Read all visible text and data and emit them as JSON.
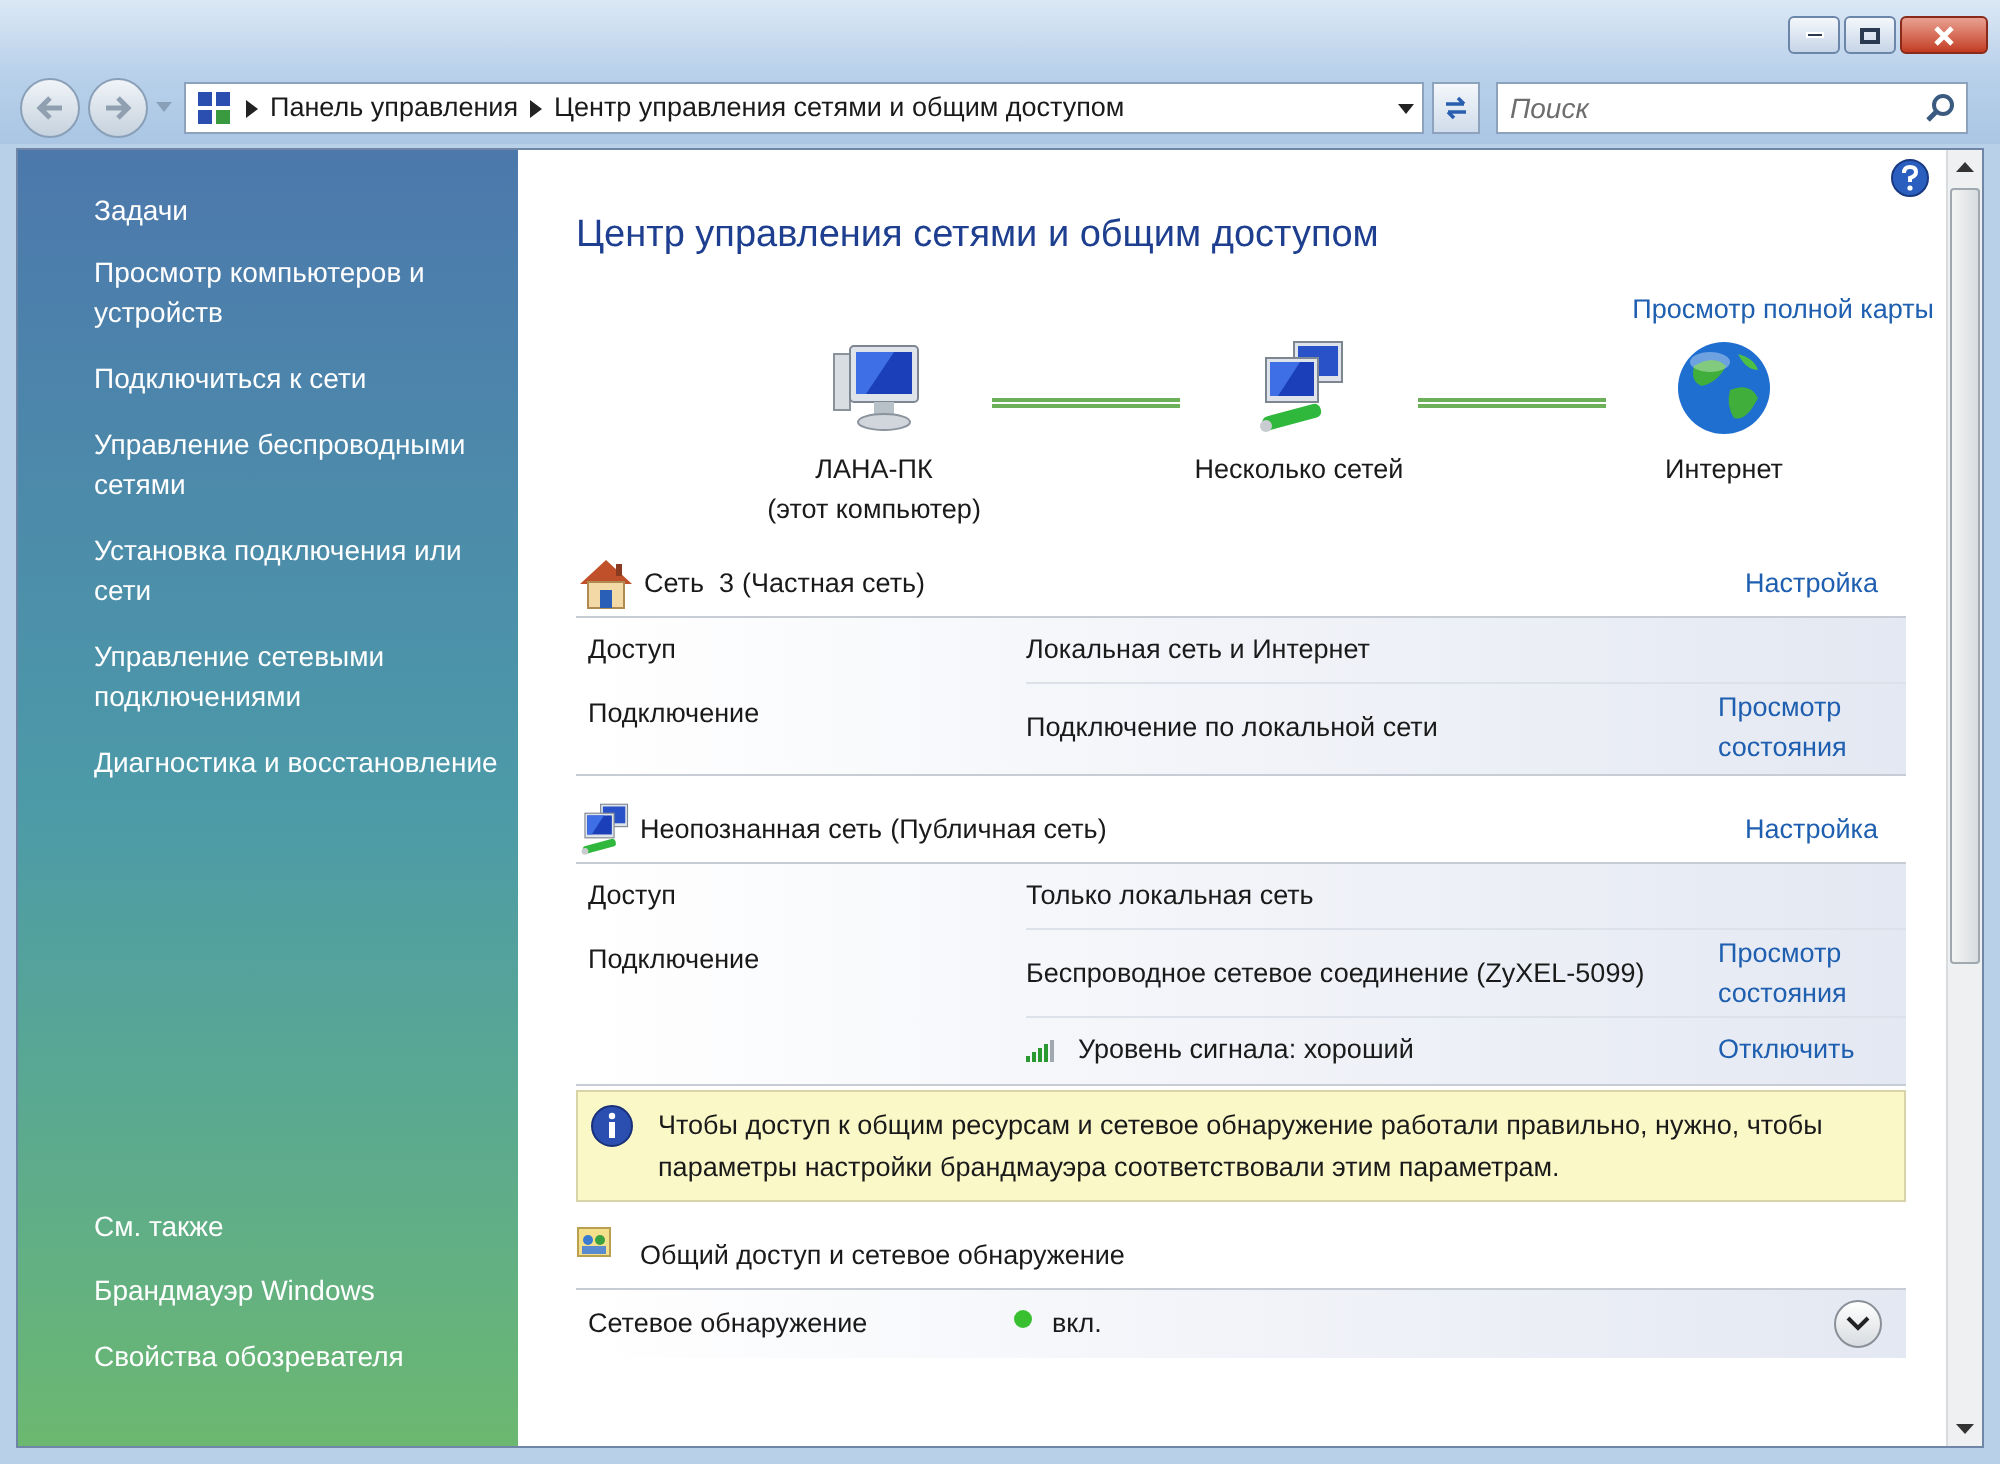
{
  "address": {
    "crumbs": [
      "Панель управления",
      "Центр управления сетями и общим доступом"
    ]
  },
  "search": {
    "placeholder": "Поиск"
  },
  "sidebar": {
    "tasks_title": "Задачи",
    "tasks": [
      "Просмотр компьютеров и устройств",
      "Подключиться к сети",
      "Управление беспроводными сетями",
      "Установка подключения или сети",
      "Управление сетевыми подключениями",
      "Диагностика и восстановление"
    ],
    "see_also_title": "См. также",
    "see_also": [
      "Брандмауэр Windows",
      "Свойства обозревателя"
    ]
  },
  "main": {
    "title": "Центр управления сетями и общим доступом",
    "map_link": "Просмотр полной карты",
    "map_nodes": [
      {
        "kind": "computer",
        "label": "ЛАНА-ПК",
        "sublabel": "(этот компьютер)"
      },
      {
        "kind": "networks",
        "label": "Несколько сетей"
      },
      {
        "kind": "globe",
        "label": "Интернет"
      }
    ],
    "networks": [
      {
        "kind": "home",
        "name": "Сеть  3",
        "category": "(Частная сеть)",
        "link": "Настройка",
        "rows": [
          {
            "kind": "plain",
            "label": "Доступ",
            "value": "Локальная сеть и Интернет"
          },
          {
            "kind": "plain",
            "label": "Подключение",
            "value": "Подключение по локальной сети",
            "link": "Просмотр состояния"
          }
        ]
      },
      {
        "kind": "public",
        "name": "Неопознанная сеть",
        "category": "(Публичная сеть)",
        "link": "Настройка",
        "rows": [
          {
            "kind": "plain",
            "label": "Доступ",
            "value": "Только локальная сеть"
          },
          {
            "kind": "plain",
            "label": "Подключение",
            "value": "Беспроводное сетевое соединение (ZyXEL-5099)",
            "link": "Просмотр состояния"
          },
          {
            "kind": "signal",
            "value": "Уровень сигнала: хороший",
            "link": "Отключить"
          }
        ]
      }
    ],
    "info": "Чтобы доступ к общим ресурсам и сетевое обнаружение работали правильно, нужно, чтобы параметры настройки брандмауэра соответствовали этим параметрам.",
    "sharing": {
      "title": "Общий доступ и сетевое обнаружение",
      "rows": [
        {
          "label": "Сетевое обнаружение",
          "value": "вкл.",
          "on": true,
          "expanded": false
        }
      ]
    }
  }
}
